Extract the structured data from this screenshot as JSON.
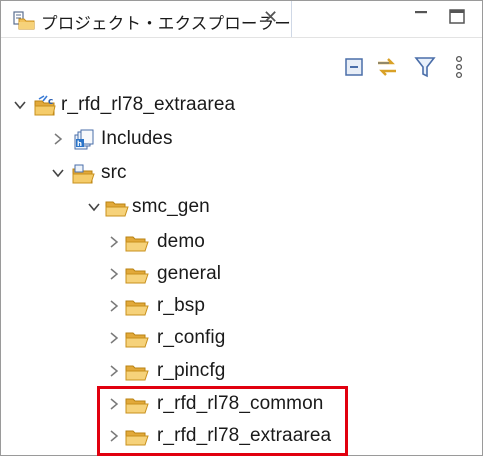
{
  "tab": {
    "title": "プロジェクト・エクスプローラー",
    "close_glyph": "✕"
  },
  "window": {
    "minimize_glyph": "—",
    "maximize_glyph": "☐"
  },
  "toolbar": {
    "collapse_all": "collapse-all-icon",
    "link_with_editor": "link-with-editor-icon",
    "filter": "filter-icon",
    "view_menu": "view-menu-icon"
  },
  "tree": {
    "project": "r_rfd_rl78_extraarea",
    "includes": "Includes",
    "src": "src",
    "smc_gen": "smc_gen",
    "children": [
      "demo",
      "general",
      "r_bsp",
      "r_config",
      "r_pincfg",
      "r_rfd_rl78_common",
      "r_rfd_rl78_extraarea"
    ]
  },
  "colors": {
    "folder": "#f2c25a",
    "folder_dark": "#d89f2a",
    "highlight": "#e1000f",
    "chevron": "#7a7a7a"
  }
}
